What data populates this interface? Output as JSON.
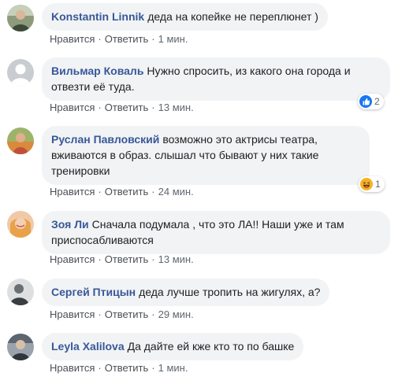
{
  "comments": [
    {
      "author": "Konstantin Linnik",
      "text": "деда на копейке не переплюнет )",
      "like": "Нравится",
      "reply": "Ответить",
      "time": "1 мин.",
      "avatar_color": "#7a8a6a"
    },
    {
      "author": "Вильмар Коваль",
      "text": "Нужно спросить, из какого она города и отвезти её туда.",
      "like": "Нравится",
      "reply": "Ответить",
      "time": "13 мин.",
      "avatar_color": "#c9ccd1",
      "reaction": {
        "icon": "like-icon",
        "count": "2"
      }
    },
    {
      "author": "Руслан Павловский",
      "text": "возможно это актрисы театра, вживаются в образ. слышал что бывают у них такие тренировки",
      "like": "Нравится",
      "reply": "Ответить",
      "time": "24 мин.",
      "avatar_color": "#b98a4f",
      "reaction": {
        "icon": "haha-icon",
        "count": "1"
      }
    },
    {
      "author": "Зоя Ли",
      "text": "Сначала подумала , что это ЛА!! Наши уже и там приспосабливаются",
      "like": "Нравится",
      "reply": "Ответить",
      "time": "13 мин.",
      "avatar_color": "#e8a24a"
    },
    {
      "author": "Сергей Птицын",
      "text": "деда лучше тропить на жигулях, а?",
      "like": "Нравится",
      "reply": "Ответить",
      "time": "29 мин.",
      "avatar_color": "#5b5f66"
    },
    {
      "author": "Leyla Xalilova",
      "text": "Да дайте ей кже кто то по башке",
      "like": "Нравится",
      "reply": "Ответить",
      "time": "1 мин.",
      "avatar_color": "#6f7a84"
    }
  ],
  "colors": {
    "author": "#385898",
    "bubble": "#f2f3f5",
    "meta": "#606770",
    "like_reaction": "#1877f2",
    "haha_reaction": "#f7b125"
  }
}
